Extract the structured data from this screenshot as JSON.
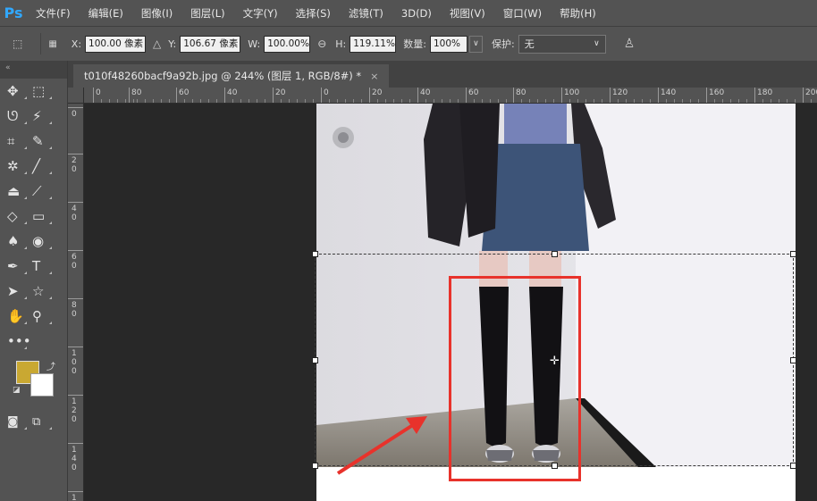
{
  "app": {
    "logo": "Ps"
  },
  "menu": [
    "文件(F)",
    "编辑(E)",
    "图像(I)",
    "图层(L)",
    "文字(Y)",
    "选择(S)",
    "滤镜(T)",
    "3D(D)",
    "视图(V)",
    "窗口(W)",
    "帮助(H)"
  ],
  "options": {
    "x_label": "X:",
    "x_value": "100.00 像素",
    "y_label": "Y:",
    "y_value": "106.67 像素",
    "w_label": "W:",
    "w_value": "100.00%",
    "h_label": "H:",
    "h_value": "119.11%",
    "amount_label": "数量:",
    "amount_value": "100%",
    "protect_label": "保护:",
    "protect_value": "无"
  },
  "document": {
    "tab_title": "t010f48260bacf9a92b.jpg @ 244% (图层 1, RGB/8#) *",
    "close": "×"
  },
  "ruler": {
    "top_labels": [
      "0",
      "80",
      "60",
      "40",
      "20",
      "0",
      "20",
      "40",
      "60",
      "80",
      "100",
      "120",
      "140",
      "160",
      "180",
      "200"
    ],
    "left_labels": [
      "0",
      "20",
      "40",
      "60",
      "80",
      "100",
      "120",
      "140",
      "1"
    ]
  },
  "colors": {
    "foreground": "#c9a832",
    "background": "#ffffff",
    "annotation": "#e8322b"
  }
}
